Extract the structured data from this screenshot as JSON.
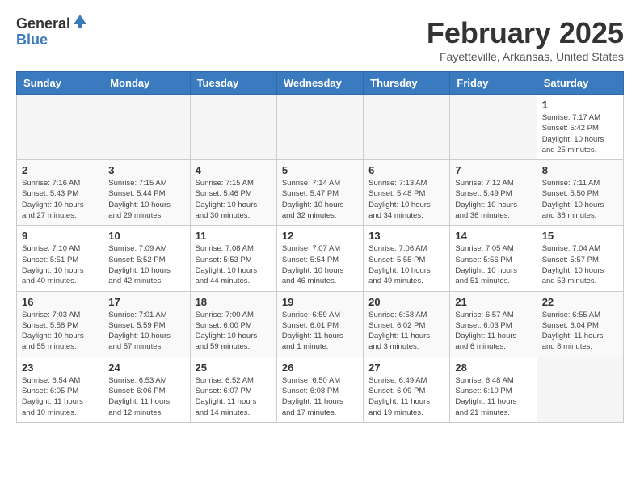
{
  "header": {
    "logo_general": "General",
    "logo_blue": "Blue",
    "title": "February 2025",
    "subtitle": "Fayetteville, Arkansas, United States"
  },
  "calendar": {
    "days_of_week": [
      "Sunday",
      "Monday",
      "Tuesday",
      "Wednesday",
      "Thursday",
      "Friday",
      "Saturday"
    ],
    "weeks": [
      [
        {
          "day": "",
          "info": ""
        },
        {
          "day": "",
          "info": ""
        },
        {
          "day": "",
          "info": ""
        },
        {
          "day": "",
          "info": ""
        },
        {
          "day": "",
          "info": ""
        },
        {
          "day": "",
          "info": ""
        },
        {
          "day": "1",
          "info": "Sunrise: 7:17 AM\nSunset: 5:42 PM\nDaylight: 10 hours and 25 minutes."
        }
      ],
      [
        {
          "day": "2",
          "info": "Sunrise: 7:16 AM\nSunset: 5:43 PM\nDaylight: 10 hours and 27 minutes."
        },
        {
          "day": "3",
          "info": "Sunrise: 7:15 AM\nSunset: 5:44 PM\nDaylight: 10 hours and 29 minutes."
        },
        {
          "day": "4",
          "info": "Sunrise: 7:15 AM\nSunset: 5:46 PM\nDaylight: 10 hours and 30 minutes."
        },
        {
          "day": "5",
          "info": "Sunrise: 7:14 AM\nSunset: 5:47 PM\nDaylight: 10 hours and 32 minutes."
        },
        {
          "day": "6",
          "info": "Sunrise: 7:13 AM\nSunset: 5:48 PM\nDaylight: 10 hours and 34 minutes."
        },
        {
          "day": "7",
          "info": "Sunrise: 7:12 AM\nSunset: 5:49 PM\nDaylight: 10 hours and 36 minutes."
        },
        {
          "day": "8",
          "info": "Sunrise: 7:11 AM\nSunset: 5:50 PM\nDaylight: 10 hours and 38 minutes."
        }
      ],
      [
        {
          "day": "9",
          "info": "Sunrise: 7:10 AM\nSunset: 5:51 PM\nDaylight: 10 hours and 40 minutes."
        },
        {
          "day": "10",
          "info": "Sunrise: 7:09 AM\nSunset: 5:52 PM\nDaylight: 10 hours and 42 minutes."
        },
        {
          "day": "11",
          "info": "Sunrise: 7:08 AM\nSunset: 5:53 PM\nDaylight: 10 hours and 44 minutes."
        },
        {
          "day": "12",
          "info": "Sunrise: 7:07 AM\nSunset: 5:54 PM\nDaylight: 10 hours and 46 minutes."
        },
        {
          "day": "13",
          "info": "Sunrise: 7:06 AM\nSunset: 5:55 PM\nDaylight: 10 hours and 49 minutes."
        },
        {
          "day": "14",
          "info": "Sunrise: 7:05 AM\nSunset: 5:56 PM\nDaylight: 10 hours and 51 minutes."
        },
        {
          "day": "15",
          "info": "Sunrise: 7:04 AM\nSunset: 5:57 PM\nDaylight: 10 hours and 53 minutes."
        }
      ],
      [
        {
          "day": "16",
          "info": "Sunrise: 7:03 AM\nSunset: 5:58 PM\nDaylight: 10 hours and 55 minutes."
        },
        {
          "day": "17",
          "info": "Sunrise: 7:01 AM\nSunset: 5:59 PM\nDaylight: 10 hours and 57 minutes."
        },
        {
          "day": "18",
          "info": "Sunrise: 7:00 AM\nSunset: 6:00 PM\nDaylight: 10 hours and 59 minutes."
        },
        {
          "day": "19",
          "info": "Sunrise: 6:59 AM\nSunset: 6:01 PM\nDaylight: 11 hours and 1 minute."
        },
        {
          "day": "20",
          "info": "Sunrise: 6:58 AM\nSunset: 6:02 PM\nDaylight: 11 hours and 3 minutes."
        },
        {
          "day": "21",
          "info": "Sunrise: 6:57 AM\nSunset: 6:03 PM\nDaylight: 11 hours and 6 minutes."
        },
        {
          "day": "22",
          "info": "Sunrise: 6:55 AM\nSunset: 6:04 PM\nDaylight: 11 hours and 8 minutes."
        }
      ],
      [
        {
          "day": "23",
          "info": "Sunrise: 6:54 AM\nSunset: 6:05 PM\nDaylight: 11 hours and 10 minutes."
        },
        {
          "day": "24",
          "info": "Sunrise: 6:53 AM\nSunset: 6:06 PM\nDaylight: 11 hours and 12 minutes."
        },
        {
          "day": "25",
          "info": "Sunrise: 6:52 AM\nSunset: 6:07 PM\nDaylight: 11 hours and 14 minutes."
        },
        {
          "day": "26",
          "info": "Sunrise: 6:50 AM\nSunset: 6:08 PM\nDaylight: 11 hours and 17 minutes."
        },
        {
          "day": "27",
          "info": "Sunrise: 6:49 AM\nSunset: 6:09 PM\nDaylight: 11 hours and 19 minutes."
        },
        {
          "day": "28",
          "info": "Sunrise: 6:48 AM\nSunset: 6:10 PM\nDaylight: 11 hours and 21 minutes."
        },
        {
          "day": "",
          "info": ""
        }
      ]
    ]
  }
}
